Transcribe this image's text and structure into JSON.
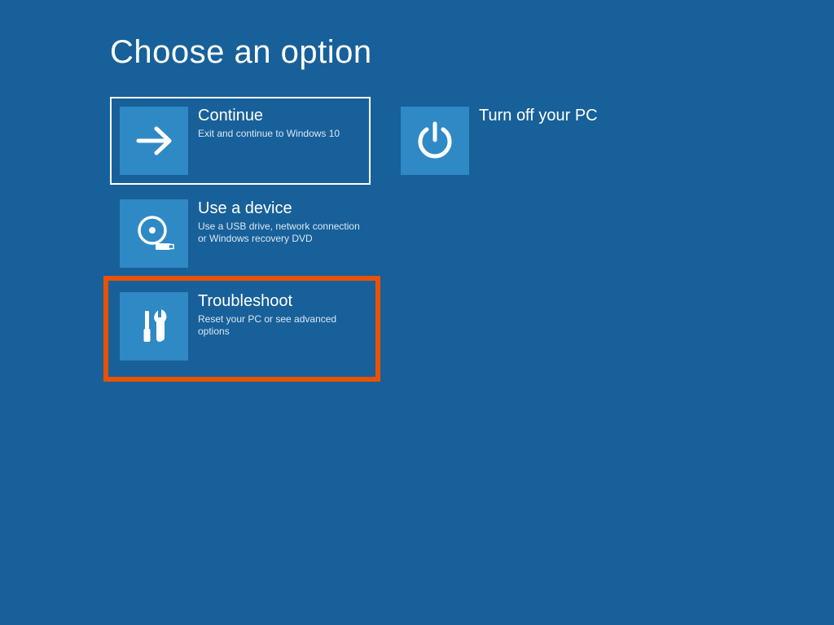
{
  "title": "Choose an option",
  "colors": {
    "background": "#186099",
    "tile_icon_bg": "#2f89c5",
    "highlight_border": "#e85200",
    "selection_border": "#ffffff"
  },
  "tiles": {
    "continue": {
      "title": "Continue",
      "description": "Exit and continue to Windows 10"
    },
    "turn_off": {
      "title": "Turn off your PC",
      "description": ""
    },
    "use_device": {
      "title": "Use a device",
      "description": "Use a USB drive, network connection or Windows recovery DVD"
    },
    "troubleshoot": {
      "title": "Troubleshoot",
      "description": "Reset your PC or see advanced options"
    }
  }
}
